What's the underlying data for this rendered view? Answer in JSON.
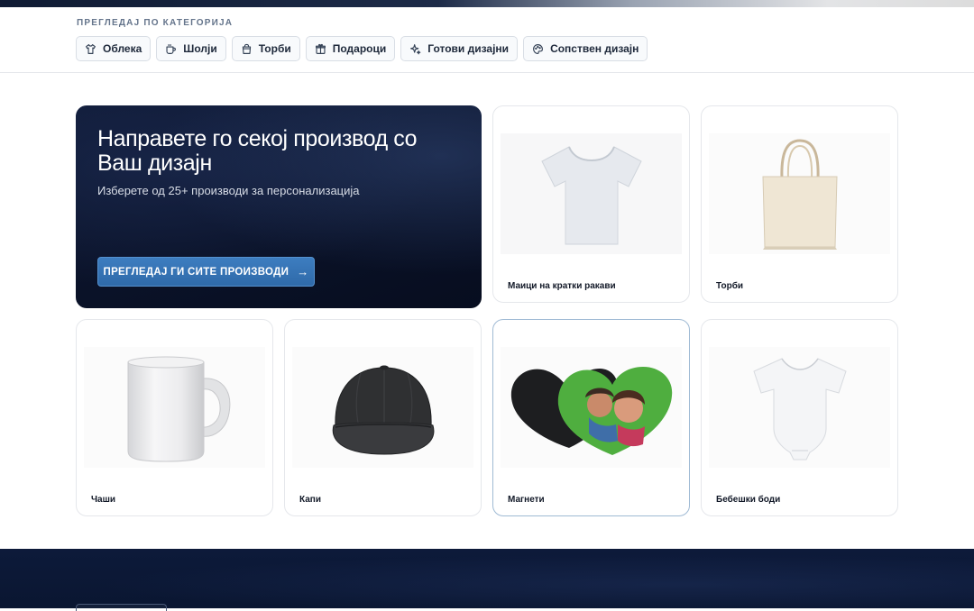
{
  "categories": {
    "title": "ПРЕГЛЕДАЈ ПО КАТЕГОРИЈА",
    "items": [
      {
        "label": "Облека",
        "icon": "shirt-icon"
      },
      {
        "label": "Шолји",
        "icon": "cup-icon"
      },
      {
        "label": "Торби",
        "icon": "bag-icon"
      },
      {
        "label": "Подароци",
        "icon": "gift-icon"
      },
      {
        "label": "Готови дизајни",
        "icon": "sparkles-icon"
      },
      {
        "label": "Сопствен дизајн",
        "icon": "palette-icon"
      }
    ]
  },
  "hero": {
    "title": "Направете го секој производ со Ваш дизајн",
    "subtitle": "Изберете од 25+ производи за персонализација",
    "button_label": "ПРЕГЛЕДАЈ ГИ СИТЕ ПРОИЗВОДИ",
    "button_icon": "arrow-right-icon"
  },
  "products": [
    {
      "label": "Маици на кратки ракави",
      "image": "t-shirt-image"
    },
    {
      "label": "Торби",
      "image": "tote-bag-image"
    },
    {
      "label": "Чаши",
      "image": "mug-image"
    },
    {
      "label": "Капи",
      "image": "cap-image"
    },
    {
      "label": "Магнети",
      "image": "heart-magnets-image"
    },
    {
      "label": "Бебешки боди",
      "image": "baby-bodysuit-image"
    }
  ],
  "colors": {
    "hero_bg": "#0a1228",
    "accent_button": "#3274b5",
    "footer_bg": "#0c1836"
  }
}
